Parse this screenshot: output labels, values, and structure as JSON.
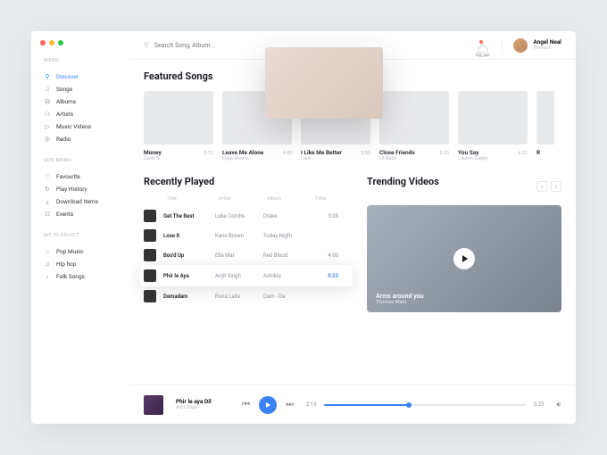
{
  "search": {
    "placeholder": "Search Song, Album..."
  },
  "user": {
    "name": "Angel Neal",
    "role": "Premium"
  },
  "sidebar": {
    "sections": [
      {
        "title": "MENU",
        "items": [
          {
            "label": "Discover",
            "icon": "⚲",
            "active": true
          },
          {
            "label": "Songs",
            "icon": "♫"
          },
          {
            "label": "Albums",
            "icon": "⊟"
          },
          {
            "label": "Artists",
            "icon": "⚇"
          },
          {
            "label": "Music Videos",
            "icon": "▷"
          },
          {
            "label": "Radio",
            "icon": "◎"
          }
        ]
      },
      {
        "title": "SUB MENU",
        "items": [
          {
            "label": "Favourite",
            "icon": "♡"
          },
          {
            "label": "Play History",
            "icon": "↻"
          },
          {
            "label": "Download Items",
            "icon": "⤓"
          },
          {
            "label": "Events",
            "icon": "☷"
          }
        ]
      },
      {
        "title": "MY PLAYLIST",
        "items": [
          {
            "label": "Pop Music",
            "icon": "○"
          },
          {
            "label": "Hip hop",
            "icon": "♫"
          },
          {
            "label": "Folk Songs",
            "icon": "♪"
          }
        ]
      }
    ]
  },
  "sections": {
    "featured": "Featured Songs",
    "recent": "Recently Played",
    "trending": "Trending Videos"
  },
  "featured": [
    {
      "title": "Money",
      "artist": "Cardi B",
      "time": "5:32"
    },
    {
      "title": "Leave Me Alone",
      "artist": "Flipp Dinero",
      "time": "4:40"
    },
    {
      "title": "I Like Me Better",
      "artist": "Lauv",
      "time": "5:03"
    },
    {
      "title": "Close Friends",
      "artist": "Lil Baby",
      "time": "5:23"
    },
    {
      "title": "You Say",
      "artist": "Lauren Daigle",
      "time": "6:32"
    },
    {
      "title": "R",
      "artist": "",
      "time": ""
    }
  ],
  "recent": {
    "columns": [
      "Title",
      "Artist",
      "Album",
      "Time"
    ],
    "rows": [
      {
        "title": "Get The Best",
        "artist": "Luke Combs",
        "album": "Drake",
        "time": "3:08"
      },
      {
        "title": "Lose It",
        "artist": "Kane Brown",
        "album": "Today Nigth",
        "time": ""
      },
      {
        "title": "Boo'd Up",
        "artist": "Ella Mai",
        "album": "Red Blood",
        "time": "4:00"
      },
      {
        "title": "Phir le Aya",
        "artist": "Arijit Singh",
        "album": "Ashikiq",
        "time": "5:23",
        "current": true
      },
      {
        "title": "Damadam",
        "artist": "Runa Laila",
        "album": "Dam - Da",
        "time": ""
      }
    ]
  },
  "trending": {
    "title": "Arms around you",
    "artist": "Thomas Rhett"
  },
  "player": {
    "title": "Phir le aya Dil",
    "artist": "Arijit Singh",
    "elapsed": "2:15",
    "total": "5:23"
  }
}
